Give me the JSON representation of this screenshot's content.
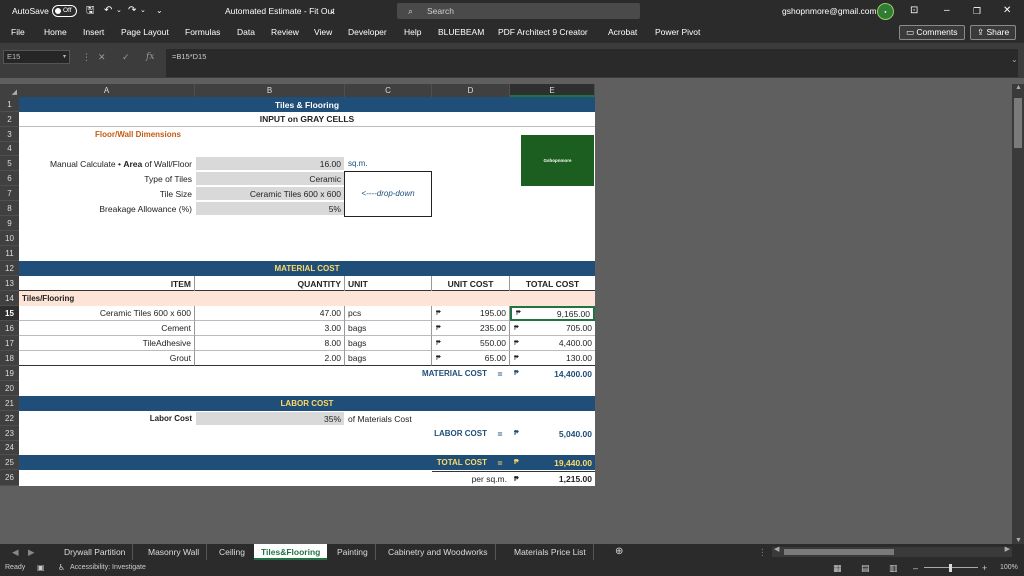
{
  "titlebar": {
    "autosave_label": "AutoSave",
    "autosave_state": "Off",
    "document_title": "Automated Estimate - Fit Out",
    "search_placeholder": "Search",
    "account_email": "gshopnmore@gmail.com"
  },
  "ribbon": {
    "tabs": [
      "File",
      "Home",
      "Insert",
      "Page Layout",
      "Formulas",
      "Data",
      "Review",
      "View",
      "Developer",
      "Help",
      "BLUEBEAM",
      "PDF Architect 9 Creator",
      "Acrobat",
      "Power Pivot"
    ],
    "comments_label": "Comments",
    "share_label": "Share"
  },
  "formula_bar": {
    "name_box": "E15",
    "formula": "=B15*D15"
  },
  "columns": [
    "A",
    "B",
    "C",
    "D",
    "E"
  ],
  "rows": [
    "1",
    "2",
    "3",
    "4",
    "5",
    "6",
    "7",
    "8",
    "9",
    "10",
    "11",
    "12",
    "13",
    "14",
    "15",
    "16",
    "17",
    "18",
    "19",
    "20",
    "21",
    "22",
    "23",
    "24",
    "25",
    "26"
  ],
  "sheet": {
    "title": "Tiles & Flooring",
    "subtitle": "INPUT on GRAY CELLS",
    "dimensions_label": "Floor/Wall Dimensions",
    "logo_text": "Gshopnmore",
    "area_label_pre": "Manual Calculate •",
    "area_label_bold": "Area",
    "area_label_post": "of Wall/Floor",
    "area_value": "16.00",
    "area_unit": "sq.m.",
    "type_label": "Type of Tiles",
    "type_value": "Ceramic",
    "size_label": "Tile Size",
    "size_value": "Ceramic Tiles 600 x 600",
    "dropdown_note": "<----drop-down",
    "breakage_label": "Breakage Allowance (%)",
    "breakage_value": "5%",
    "material_header": "MATERIAL COST",
    "col_item": "ITEM",
    "col_qty": "QUANTITY",
    "col_unit": "UNIT",
    "col_unitcost": "UNIT COST",
    "col_total": "TOTAL COST",
    "group_label": "Tiles/Flooring",
    "currency": "₱",
    "items": [
      {
        "item": "Ceramic Tiles 600 x 600",
        "qty": "47.00",
        "unit": "pcs",
        "unit_cost": "195.00",
        "total": "9,165.00"
      },
      {
        "item": "Cement",
        "qty": "3.00",
        "unit": "bags",
        "unit_cost": "235.00",
        "total": "705.00"
      },
      {
        "item": "TileAdhesive",
        "qty": "8.00",
        "unit": "bags",
        "unit_cost": "550.00",
        "total": "4,400.00"
      },
      {
        "item": "Grout",
        "qty": "2.00",
        "unit": "bags",
        "unit_cost": "65.00",
        "total": "130.00"
      }
    ],
    "material_total_label": "MATERIAL COST",
    "equals": "=",
    "material_total": "14,400.00",
    "labor_header": "LABOR COST",
    "labor_label": "Labor Cost",
    "labor_pct": "35%",
    "labor_note": "of Materials Cost",
    "labor_total_label": "LABOR COST",
    "labor_total": "5,040.00",
    "grand_total_label": "TOTAL COST",
    "grand_total": "19,440.00",
    "per_sqm_label": "per sq.m.",
    "per_sqm": "1,215.00"
  },
  "sheet_tabs": [
    "Drywall Partition",
    "Masonry Wall",
    "Ceiling",
    "Tiles&Flooring",
    "Painting",
    "Cabinetry and Woodworks",
    "Materials Price List"
  ],
  "active_tab": "Tiles&Flooring",
  "status": {
    "mode": "Ready",
    "accessibility": "Accessibility: Investigate",
    "zoom": "100%"
  },
  "colors": {
    "navy": "#1f4e79",
    "orange": "#c55a11",
    "gold": "#ffd966",
    "gray_input": "#d9d9d9",
    "peach": "#fce4d6",
    "active_tab": "#217346"
  }
}
